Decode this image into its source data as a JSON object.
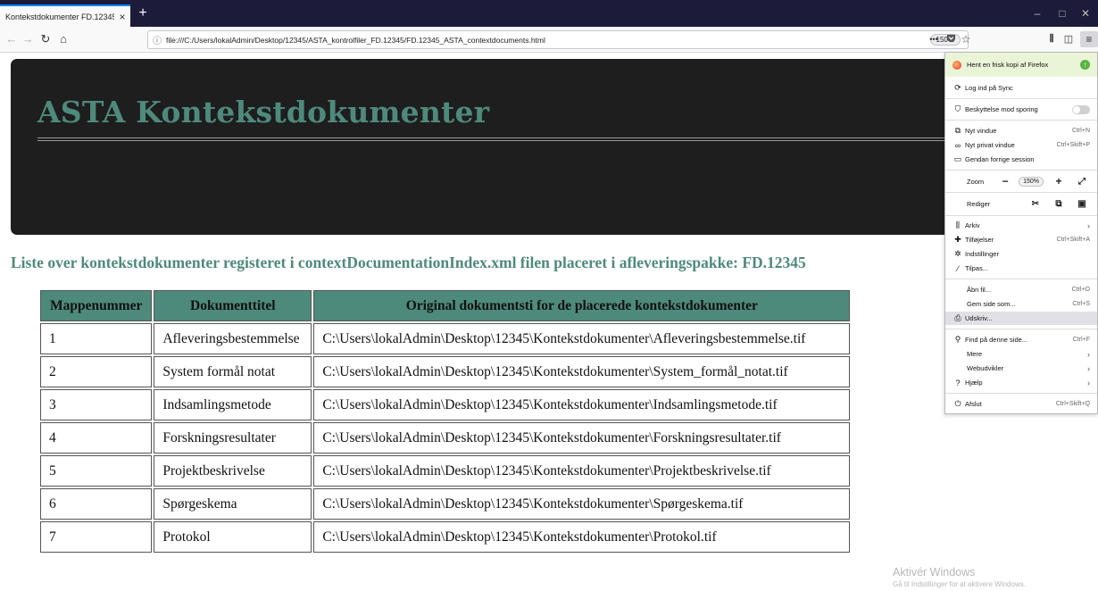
{
  "browser": {
    "tab_title": "Kontekstdokumenter FD.12345",
    "tab_close": "×",
    "new_tab": "+",
    "url": "file:///C:/Users/lokalAdmin/Desktop/12345/ASTA_kontrolfiler_FD.12345/FD.12345_ASTA_contextdocuments.html",
    "zoom": "150%",
    "page_actions": "•••"
  },
  "page": {
    "title": "ASTA Kontekstdokumenter",
    "subtitle": "Liste over kontekstdokumenter registeret i contextDocumentationIndex.xml filen placeret i afleveringspakke: FD.12345",
    "table": {
      "headers": [
        "Mappenummer",
        "Dokumenttitel",
        "Original dokumentsti for de placerede kontekstdokumenter"
      ],
      "rows": [
        [
          "1",
          "Afleveringsbestemmelse",
          "C:\\Users\\lokalAdmin\\Desktop\\12345\\Kontekstdokumenter\\Afleveringsbestemmelse.tif"
        ],
        [
          "2",
          "System formål notat",
          "C:\\Users\\lokalAdmin\\Desktop\\12345\\Kontekstdokumenter\\System_formål_notat.tif"
        ],
        [
          "3",
          "Indsamlingsmetode",
          "C:\\Users\\lokalAdmin\\Desktop\\12345\\Kontekstdokumenter\\Indsamlingsmetode.tif"
        ],
        [
          "4",
          "Forskningsresultater",
          "C:\\Users\\lokalAdmin\\Desktop\\12345\\Kontekstdokumenter\\Forskningsresultater.tif"
        ],
        [
          "5",
          "Projektbeskrivelse",
          "C:\\Users\\lokalAdmin\\Desktop\\12345\\Kontekstdokumenter\\Projektbeskrivelse.tif"
        ],
        [
          "6",
          "Spørgeskema",
          "C:\\Users\\lokalAdmin\\Desktop\\12345\\Kontekstdokumenter\\Spørgeskema.tif"
        ],
        [
          "7",
          "Protokol",
          "C:\\Users\\lokalAdmin\\Desktop\\12345\\Kontekstdokumenter\\Protokol.tif"
        ]
      ]
    }
  },
  "menu": {
    "update": "Hent en frisk kopi af Firefox",
    "sync": "Log ind på Sync",
    "tracking": "Beskyttelse mod sporing",
    "new_window": "Nyt vindue",
    "new_window_short": "Ctrl+N",
    "private_window": "Nyt privat vindue",
    "private_window_short": "Ctrl+Skift+P",
    "restore_session": "Gendan forrige session",
    "zoom_label": "Zoom",
    "zoom_minus": "−",
    "zoom_value": "150%",
    "zoom_plus": "+",
    "zoom_fullscreen": "⤢",
    "edit_label": "Rediger",
    "library": "Arkiv",
    "addons": "Tilføjelser",
    "addons_short": "Ctrl+Skift+A",
    "options": "Indstillinger",
    "customize": "Tilpas...",
    "open_file": "Åbn fil...",
    "open_file_short": "Ctrl+O",
    "save_page": "Gem side som...",
    "save_page_short": "Ctrl+S",
    "print": "Udskriv...",
    "find": "Find på denne side...",
    "find_short": "Ctrl+F",
    "more": "Mere",
    "webdev": "Webudvikler",
    "help": "Hjælp",
    "quit": "Afslut",
    "quit_short": "Ctrl+Skift+Q"
  },
  "watermark": {
    "line1": "Aktivér Windows",
    "line2": "Gå til Indstillinger for at aktivere Windows."
  }
}
